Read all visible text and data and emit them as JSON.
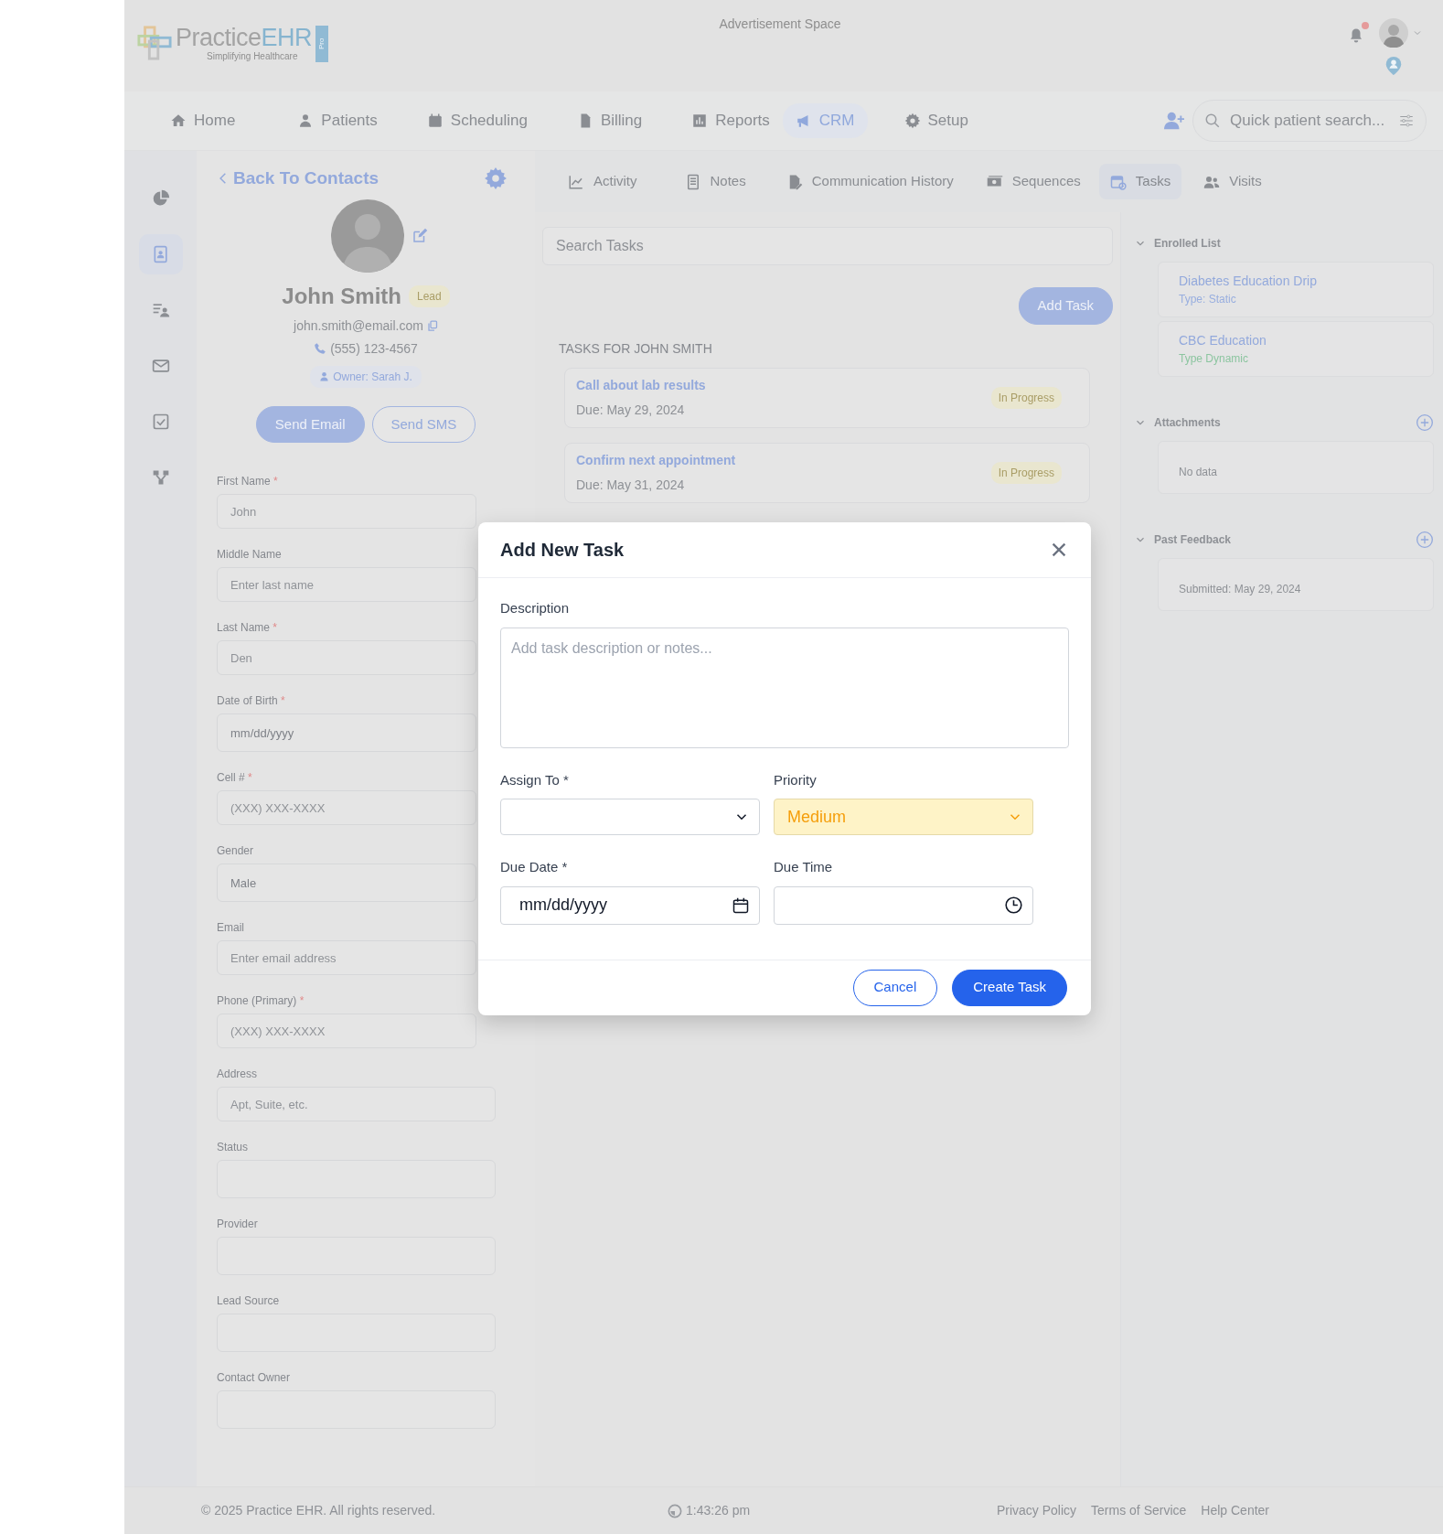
{
  "header": {
    "logo": {
      "word1": "Practice",
      "word2": "EHR",
      "tag": "Pro",
      "tagline": "Simplifying Healthcare"
    },
    "ad_text": "Advertisement Space",
    "notification_dot": true
  },
  "nav": {
    "items": [
      {
        "label": "Home",
        "selected": false
      },
      {
        "label": "Patients",
        "selected": false
      },
      {
        "label": "Scheduling",
        "selected": false
      },
      {
        "label": "Billing",
        "selected": false
      },
      {
        "label": "Reports",
        "selected": false
      },
      {
        "label": "CRM",
        "selected": true
      },
      {
        "label": "Setup",
        "selected": false
      }
    ],
    "search": {
      "placeholder": "Quick patient search..."
    }
  },
  "sidebar": {
    "items": [
      {
        "selected": false
      },
      {
        "selected": true
      },
      {
        "selected": false
      },
      {
        "selected": false
      },
      {
        "selected": false
      },
      {
        "selected": false
      }
    ]
  },
  "contact": {
    "back_link": "Back To Contacts",
    "name": "John Smith",
    "badge": "Lead",
    "email": "john.smith@email.com",
    "phone": "(555) 123-4567",
    "owner": "Owner: Sarah J.",
    "buttons": [
      "Send Email",
      "Send SMS"
    ],
    "fields": [
      {
        "label": "First Name",
        "required_mark": "*",
        "kind": "text",
        "placeholder": "John"
      },
      {
        "label": "Middle Name",
        "kind": "text",
        "placeholder": "Enter last name"
      },
      {
        "label": "Last Name",
        "required_mark": "*",
        "kind": "text",
        "placeholder": "Den"
      },
      {
        "label": "Date of Birth",
        "required_mark": "*",
        "kind": "date",
        "value": "mm/dd/yyyy"
      },
      {
        "label": "Cell #",
        "required_mark": "*",
        "kind": "text",
        "placeholder": "(XXX) XXX-XXXX"
      },
      {
        "label": "Gender",
        "kind": "select",
        "value": "Male"
      },
      {
        "label": "Email",
        "kind": "text",
        "placeholder": "Enter email address"
      },
      {
        "label": "Phone (Primary)",
        "required_mark": "*",
        "kind": "text",
        "placeholder": "(XXX) XXX-XXXX"
      },
      {
        "label": "Address",
        "kind": "text",
        "placeholder": "Apt, Suite, etc."
      },
      {
        "label": "Status",
        "kind": "select"
      },
      {
        "label": "Provider",
        "kind": "select"
      },
      {
        "label": "Lead Source",
        "kind": "select"
      },
      {
        "label": "Contact Owner",
        "kind": "select"
      }
    ]
  },
  "tabs": [
    {
      "label": "Activity",
      "selected": false
    },
    {
      "label": "Notes",
      "selected": false
    },
    {
      "label": "Communication History",
      "selected": false
    },
    {
      "label": "Sequences",
      "selected": false
    },
    {
      "label": "Tasks",
      "selected": true
    },
    {
      "label": "Visits",
      "selected": false
    }
  ],
  "tasks": {
    "search_placeholder": "Search Tasks",
    "add_button": "Add Task",
    "heading": "TASKS FOR JOHN SMITH",
    "items": [
      {
        "title": "Call about lab results",
        "due": "Due: May 29, 2024",
        "status": "In Progress"
      },
      {
        "title": "Confirm next appointment",
        "due": "Due: May 31, 2024",
        "status": "In Progress"
      }
    ]
  },
  "right_panel": {
    "sections": [
      {
        "title": "Enrolled List",
        "expanded": true,
        "can_add": false,
        "cards": [
          {
            "title": "Diabetes Education Drip",
            "subtitle": "Type: Static",
            "color": "#98aedf"
          },
          {
            "title": "CBC Education",
            "subtitle": "Type Dynamic",
            "color": "#8cc5a0"
          }
        ]
      },
      {
        "title": "Attachments",
        "expanded": true,
        "can_add": true,
        "cards": [
          {
            "note": "No data"
          }
        ]
      },
      {
        "title": "Past Feedback",
        "expanded": true,
        "can_add": true,
        "cards": [
          {
            "note": "Submitted:  May 29, 2024"
          }
        ]
      }
    ]
  },
  "modal": {
    "title": "Add New Task",
    "fields": [
      {
        "label": "Description",
        "kind": "textarea",
        "placeholder": "Add task description or notes..."
      },
      {
        "label": "Assign To *",
        "kind": "select",
        "highlighted": false
      },
      {
        "label": "Priority",
        "kind": "select",
        "value": "Medium",
        "highlighted": true
      },
      {
        "label": "Due Date *",
        "kind": "date",
        "value": "mm/dd/yyyy"
      },
      {
        "label": "Due Time",
        "kind": "time"
      }
    ],
    "buttons": [
      {
        "label": "Cancel",
        "kind": "secondary"
      },
      {
        "label": "Create Task",
        "kind": "primary"
      }
    ]
  },
  "footer": {
    "copyright": "© 2025 Practice EHR. All rights reserved.",
    "time": "1:43:26 pm",
    "links": [
      "Privacy Policy",
      "Terms of Service",
      "Help Center"
    ]
  }
}
